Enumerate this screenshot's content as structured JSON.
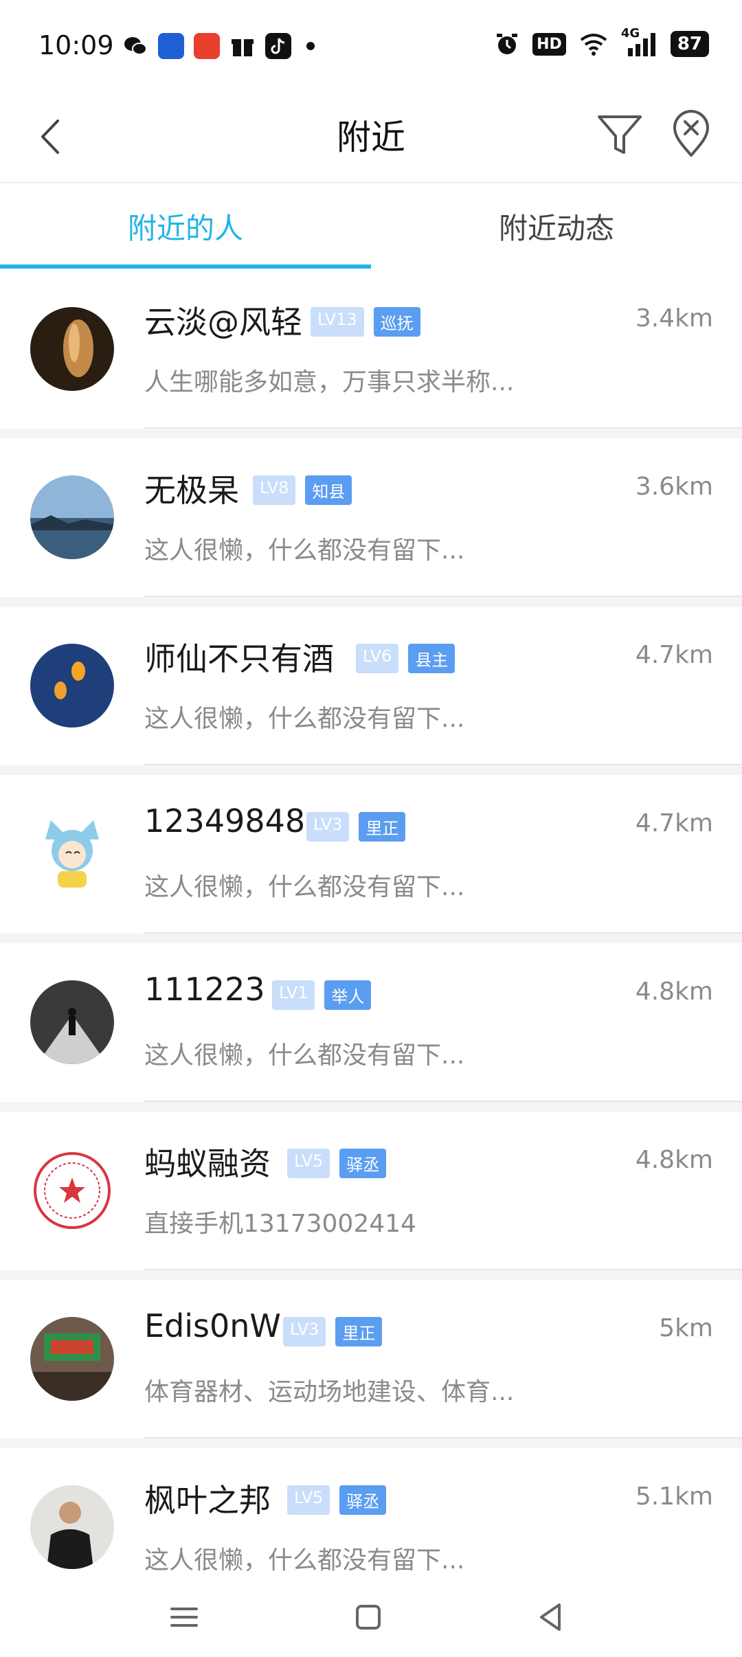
{
  "status_bar": {
    "time": "10:09",
    "network": "4G",
    "battery": "87",
    "hd": "HD"
  },
  "header": {
    "title": "附近"
  },
  "tabs": [
    {
      "label": "附近的人",
      "active": true
    },
    {
      "label": "附近动态",
      "active": false
    }
  ],
  "users": [
    {
      "name": "云淡@风轻",
      "level": "LV13",
      "rank": "巡抚",
      "distance": "3.4km",
      "bio": "人生哪能多如意，万事只求半称..."
    },
    {
      "name": "无极杲",
      "level": "LV8",
      "rank": "知县",
      "distance": "3.6km",
      "bio": "这人很懒，什么都没有留下..."
    },
    {
      "name": "师仙不只有酒",
      "level": "LV6",
      "rank": "县主",
      "distance": "4.7km",
      "bio": "这人很懒，什么都没有留下..."
    },
    {
      "name": "12349848",
      "level": "LV3",
      "rank": "里正",
      "distance": "4.7km",
      "bio": "这人很懒，什么都没有留下..."
    },
    {
      "name": "111223",
      "level": "LV1",
      "rank": "举人",
      "distance": "4.8km",
      "bio": "这人很懒，什么都没有留下..."
    },
    {
      "name": "蚂蚁融资",
      "level": "LV5",
      "rank": "驿丞",
      "distance": "4.8km",
      "bio": "直接手机13173002414"
    },
    {
      "name": "Edis0nW",
      "level": "LV3",
      "rank": "里正",
      "distance": "5km",
      "bio": "体育器材、运动场地建设、体育..."
    },
    {
      "name": "枫叶之邦",
      "level": "LV5",
      "rank": "驿丞",
      "distance": "5.1km",
      "bio": "这人很懒，什么都没有留下..."
    }
  ],
  "colors": {
    "accent": "#21b3e8",
    "badge_level": "#c8defa",
    "badge_rank": "#5b9df0"
  }
}
